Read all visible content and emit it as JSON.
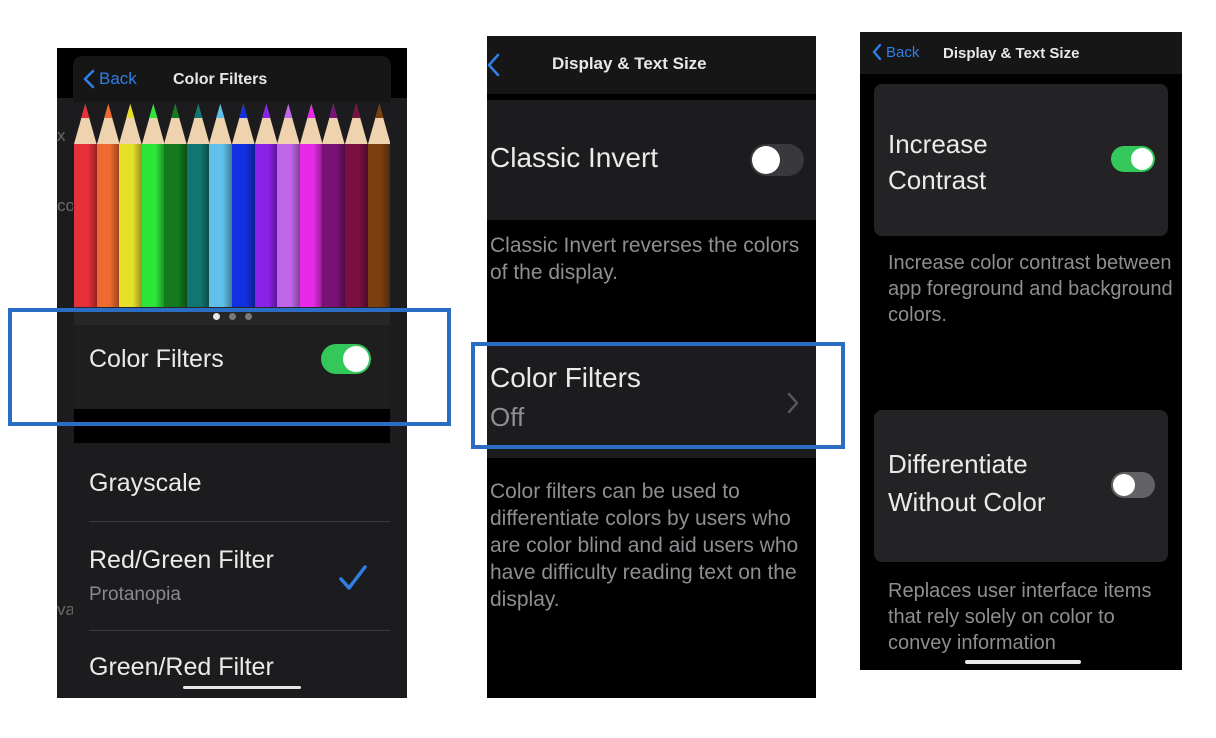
{
  "panels": [
    {
      "nav": {
        "back_label": "Back",
        "title": "Color Filters"
      },
      "pencil_colors": [
        "#e8303a",
        "#ee6a2e",
        "#e6e02a",
        "#2ee63a",
        "#137a1e",
        "#127570",
        "#5fc1ea",
        "#1230e0",
        "#8a22ea",
        "#c066ea",
        "#e82ae8",
        "#7a1275",
        "#7a1040",
        "#7a4010"
      ],
      "page_dots": {
        "count": 3,
        "active": 0
      },
      "color_filters_toggle": {
        "label": "Color Filters",
        "on": true
      },
      "filters": [
        {
          "label": "Grayscale",
          "sub": "",
          "selected": false
        },
        {
          "label": "Red/Green Filter",
          "sub": "Protanopia",
          "selected": true
        },
        {
          "label": "Green/Red Filter",
          "sub": "",
          "selected": false
        }
      ],
      "ghost_text": [
        "x",
        "co",
        "va"
      ]
    },
    {
      "nav": {
        "title": "Display & Text Size"
      },
      "classic_invert": {
        "label": "Classic Invert",
        "on": false
      },
      "classic_invert_desc": "Classic Invert reverses the colors of the display.",
      "color_filters": {
        "label": "Color Filters",
        "value": "Off"
      },
      "color_filters_desc": "Color filters can be used to differentiate colors by users who are color blind and aid users who have difficulty reading text on the display."
    },
    {
      "nav": {
        "back_label": "Back",
        "title": "Display & Text Size"
      },
      "increase_contrast": {
        "label_line1": "Increase",
        "label_line2": "Contrast",
        "on": true
      },
      "increase_contrast_desc": "Increase color contrast between app foreground and background colors.",
      "differentiate": {
        "label_line1": "Differentiate",
        "label_line2": "Without Color",
        "on": false
      },
      "differentiate_desc": "Replaces user interface items that rely solely on color to convey information"
    }
  ],
  "colors": {
    "accent": "#2f7fe6",
    "toggle_on": "#34c759",
    "highlight": "#2b6cc4"
  }
}
